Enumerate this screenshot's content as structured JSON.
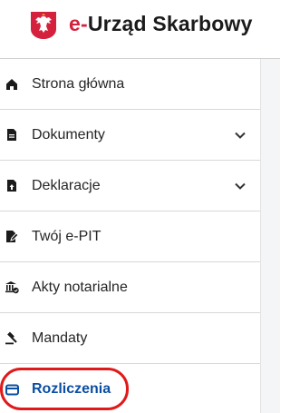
{
  "header": {
    "title_prefix": "e-",
    "title_main": "Urząd Skarbowy"
  },
  "nav": {
    "items": [
      {
        "label": "Strona główna",
        "icon": "home-icon",
        "expandable": false
      },
      {
        "label": "Dokumenty",
        "icon": "document-icon",
        "expandable": true
      },
      {
        "label": "Deklaracje",
        "icon": "declaration-upload-icon",
        "expandable": true
      },
      {
        "label": "Twój e-PIT",
        "icon": "document-edit-icon",
        "expandable": false
      },
      {
        "label": "Akty notarialne",
        "icon": "notary-building-icon",
        "expandable": false
      },
      {
        "label": "Mandaty",
        "icon": "gavel-icon",
        "expandable": false
      },
      {
        "label": "Rozliczenia",
        "icon": "wallet-icon",
        "expandable": false,
        "active": true
      }
    ]
  },
  "colors": {
    "accent_red": "#d4213d",
    "active_blue": "#0b4ea2",
    "highlight_ring": "#e0191b"
  }
}
